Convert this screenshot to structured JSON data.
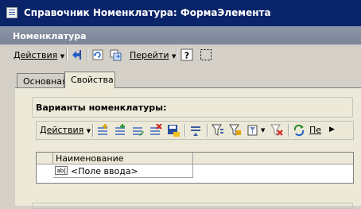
{
  "window": {
    "title": "Справочник Номенклатура: ФормаЭлемента",
    "header": "Номенклатура"
  },
  "toolbar": {
    "actions_label": "Действия",
    "goto_label": "Перейти"
  },
  "tabs": [
    {
      "label": "Основная",
      "active": false
    },
    {
      "label": "Свойства",
      "active": true
    }
  ],
  "group": {
    "title": "Варианты номенклатуры:"
  },
  "inner_toolbar": {
    "actions_label": "Действия",
    "more_label": "Пе"
  },
  "table": {
    "columns": [
      "Наименование"
    ],
    "rows": [
      {
        "icon_text": "ab|",
        "value": "<Поле ввода>"
      }
    ]
  }
}
